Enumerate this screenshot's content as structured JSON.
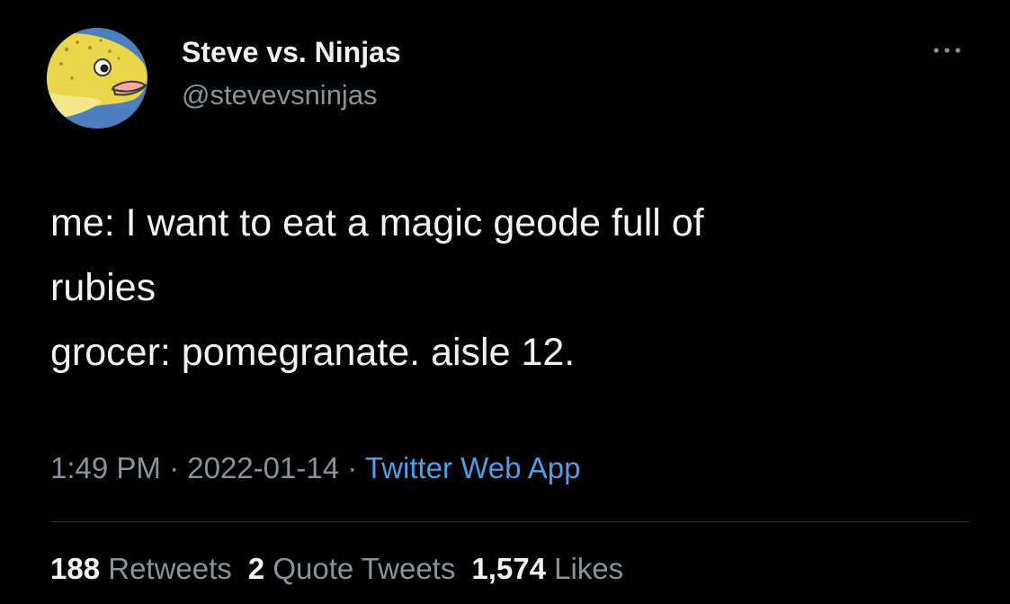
{
  "author": {
    "display_name": "Steve vs. Ninjas",
    "handle": "@stevevsninjas",
    "avatar_icon": "yellow-fish-avatar"
  },
  "more_icon": "ellipsis-icon",
  "tweet": {
    "text": "me: I want to eat a magic geode full of\nrubies\ngrocer: pomegranate. aisle 12."
  },
  "meta": {
    "time": "1:49 PM",
    "separator": "·",
    "date": "2022-01-14",
    "source": "Twitter Web App"
  },
  "stats": {
    "retweets_count": "188",
    "retweets_label": "Retweets",
    "quotes_count": "2",
    "quotes_label": "Quote Tweets",
    "likes_count": "1,574",
    "likes_label": "Likes"
  },
  "colors": {
    "background": "#000000",
    "text_primary": "#f1f2f3",
    "text_secondary": "#8b9299",
    "link": "#4a9fe8",
    "divider": "#2f3336"
  }
}
